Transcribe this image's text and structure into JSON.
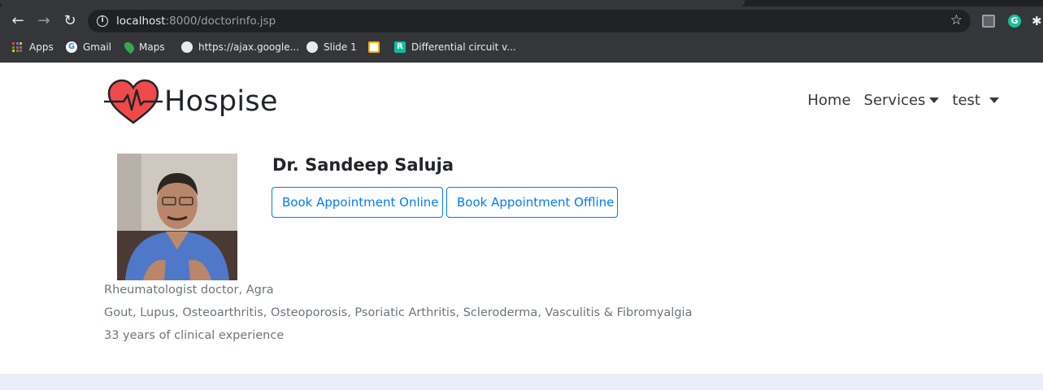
{
  "browser": {
    "url_host": "localhost",
    "url_rest": ":8000/doctorinfo.jsp",
    "bookmarks": [
      {
        "label": "Apps",
        "icon": "apps-grid-icon"
      },
      {
        "label": "Gmail",
        "icon": "google-icon"
      },
      {
        "label": "Maps",
        "icon": "maps-pin-icon"
      },
      {
        "label": "https://ajax.google...",
        "icon": "globe-icon"
      },
      {
        "label": "Slide 1",
        "icon": "globe-icon"
      },
      {
        "label": "",
        "icon": "slides-icon"
      },
      {
        "label": "Differential circuit v...",
        "icon": "r-icon"
      }
    ],
    "extension_letter": "G"
  },
  "site": {
    "brand": "Hospise",
    "nav": {
      "home": "Home",
      "services": "Services",
      "user": "test"
    }
  },
  "doctor": {
    "name": "Dr. Sandeep Saluja",
    "book_online": "Book Appointment Online",
    "book_offline": "Book Appointment Offline",
    "specialty_location": "Rheumatologist doctor, Agra",
    "conditions": "Gout, Lupus, Osteoarthritis, Osteoporosis, Psoriatic Arthritis, Scleroderma, Vasculitis & Fibromyalgia",
    "experience": "33 years of clinical experience"
  },
  "colors": {
    "accent": "#007bff",
    "logo_heart": "#ef4a4a",
    "muted_text": "#6c757d",
    "chrome_dark": "#35363a"
  }
}
